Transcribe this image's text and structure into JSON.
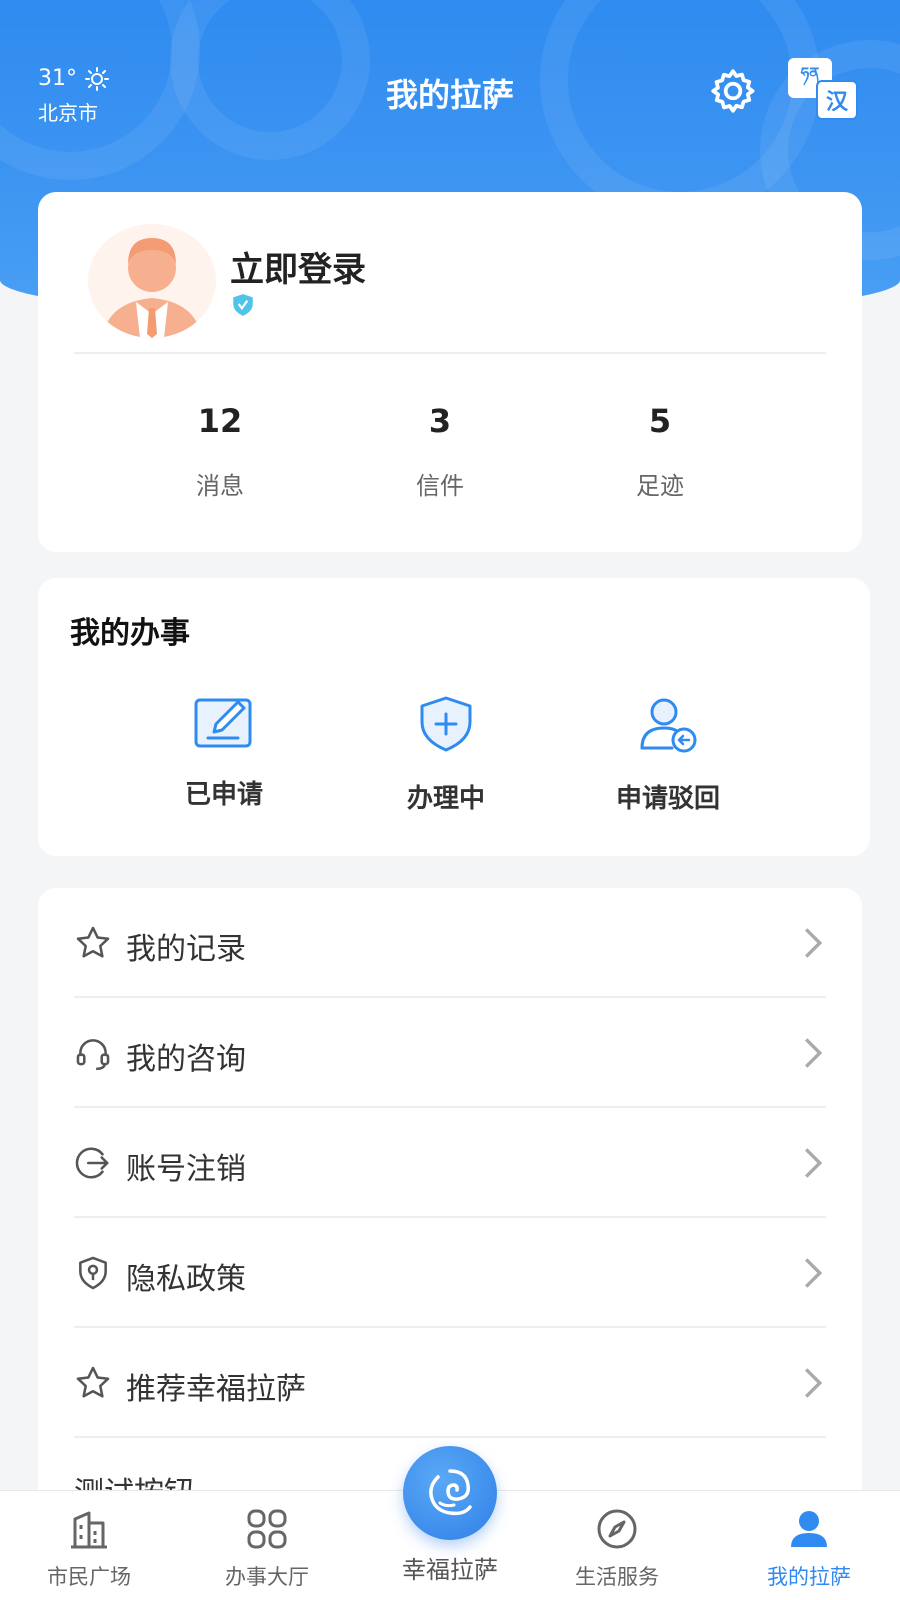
{
  "header": {
    "temperature": "31°",
    "city": "北京市",
    "title": "我的拉萨",
    "lang_top": "ཧན",
    "lang_bottom": "汉"
  },
  "profile": {
    "login_label": "立即登录",
    "stats": [
      {
        "value": "12",
        "label": "消息"
      },
      {
        "value": "3",
        "label": "信件"
      },
      {
        "value": "5",
        "label": "足迹"
      }
    ]
  },
  "affairs": {
    "title": "我的办事",
    "items": [
      {
        "label": "已申请",
        "icon": "edit-icon"
      },
      {
        "label": "办理中",
        "icon": "shield-plus-icon"
      },
      {
        "label": "申请驳回",
        "icon": "user-return-icon"
      }
    ]
  },
  "menu": {
    "items": [
      {
        "label": "我的记录",
        "icon": "star-icon"
      },
      {
        "label": "我的咨询",
        "icon": "headset-icon"
      },
      {
        "label": "账号注销",
        "icon": "logout-icon"
      },
      {
        "label": "隐私政策",
        "icon": "shield-key-icon"
      },
      {
        "label": "推荐幸福拉萨",
        "icon": "star-icon"
      },
      {
        "label": "测试按钮",
        "icon": ""
      }
    ]
  },
  "tabbar": {
    "items": [
      {
        "label": "市民广场",
        "icon": "building-icon"
      },
      {
        "label": "办事大厅",
        "icon": "grid-icon"
      },
      {
        "label": "幸福拉萨",
        "icon": "lhasa-logo-icon"
      },
      {
        "label": "生活服务",
        "icon": "compass-icon"
      },
      {
        "label": "我的拉萨",
        "icon": "user-icon"
      }
    ],
    "active_index": 4
  },
  "colors": {
    "primary": "#2f8bf0",
    "background": "#f4f5f7",
    "verify_badge": "#4fc3e8"
  }
}
